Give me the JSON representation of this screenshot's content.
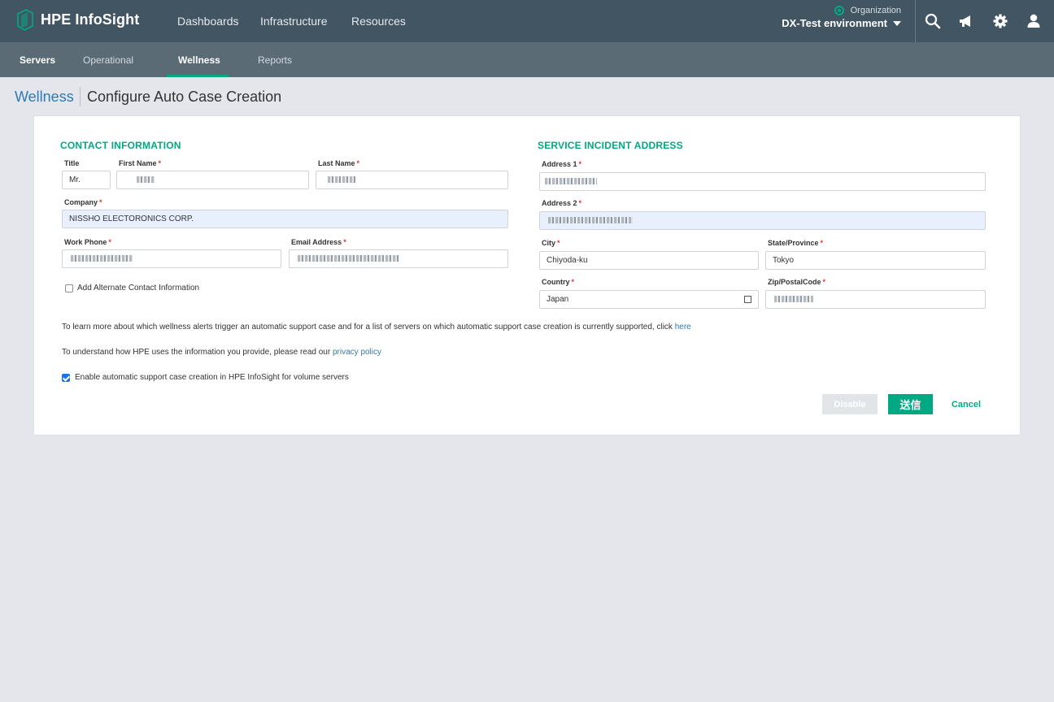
{
  "app": {
    "name": "HPE InfoSight",
    "nav": [
      "Dashboards",
      "Infrastructure",
      "Resources"
    ],
    "org_label": "Organization",
    "org_name": "DX-Test environment"
  },
  "icons": [
    "hpe-logo-icon",
    "search-icon",
    "megaphone-icon",
    "gear-icon",
    "user-icon"
  ],
  "colors": {
    "topbar": "#425563",
    "subbar": "#5b6b76",
    "accent": "#01a982",
    "link": "#2c7bb6"
  },
  "subnav": [
    "Servers",
    "Operational",
    "Wellness",
    "Reports"
  ],
  "breadcrumb": {
    "parent": "Wellness",
    "title": "Configure Auto Case Creation"
  },
  "contact": {
    "heading": "CONTACT INFORMATION",
    "title_label": "Title",
    "title_value": "Mr.",
    "first_name_label": "First Name",
    "last_name_label": "Last Name",
    "company_label": "Company",
    "company_value": "NISSHO ELECTORONICS CORP.",
    "work_phone_label": "Work Phone",
    "email_label": "Email Address",
    "alt_contact_label": "Add Alternate Contact Information",
    "required_mark": "*"
  },
  "address": {
    "heading": "SERVICE INCIDENT ADDRESS",
    "address1_label": "Address 1",
    "address2_label": "Address 2",
    "city_label": "City",
    "city_value": "Chiyoda-ku",
    "state_label": "State/Province",
    "state_value": "Tokyo",
    "country_label": "Country",
    "country_value": "Japan",
    "zip_label": "Zip/PostalCode"
  },
  "info": {
    "line1": "To learn more about which wellness alerts trigger an automatic support case and for a list of servers on which automatic support case creation is currently supported, click",
    "line1_link": "here",
    "line2": "To understand how HPE uses the information you provide, please read our",
    "line2_link": "privacy policy",
    "enable_label": "Enable automatic support case creation in HPE InfoSight for volume servers"
  },
  "buttons": {
    "disable": "Disable",
    "submit": "送信",
    "cancel": "Cancel"
  }
}
